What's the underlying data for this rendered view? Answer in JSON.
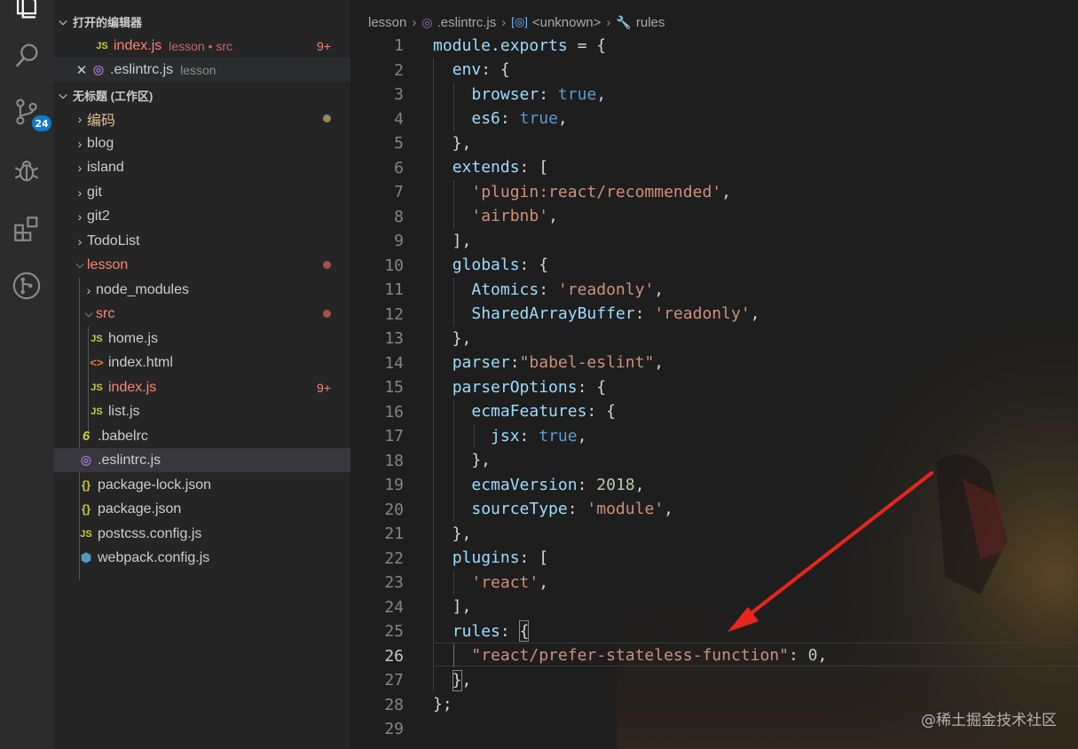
{
  "activity_bar": {
    "icons": [
      "explorer-icon",
      "search-icon",
      "source-control-icon",
      "debug-icon",
      "extensions-icon",
      "git-graph-icon"
    ],
    "source_control_badge": "24"
  },
  "sidebar": {
    "open_editors_header": "打开的编辑器",
    "open_editors": [
      {
        "name": "index.js",
        "path": "lesson • src",
        "count": "9+"
      },
      {
        "name": ".eslintrc.js",
        "path": "lesson"
      }
    ],
    "workspace_header": "无标题 (工作区)",
    "tree": [
      {
        "label": "编码"
      },
      {
        "label": "blog"
      },
      {
        "label": "island"
      },
      {
        "label": "git"
      },
      {
        "label": "git2"
      },
      {
        "label": "TodoList"
      },
      {
        "label": "lesson"
      },
      {
        "label": "node_modules"
      },
      {
        "label": "src"
      },
      {
        "label": "home.js"
      },
      {
        "label": "index.html"
      },
      {
        "label": "index.js",
        "count": "9+"
      },
      {
        "label": "list.js"
      },
      {
        "label": ".babelrc"
      },
      {
        "label": ".eslintrc.js"
      },
      {
        "label": "package-lock.json"
      },
      {
        "label": "package.json"
      },
      {
        "label": "postcss.config.js"
      },
      {
        "label": "webpack.config.js"
      }
    ]
  },
  "breadcrumb": {
    "folder": "lesson",
    "file": ".eslintrc.js",
    "symbol": "<unknown>",
    "property": "rules"
  },
  "editor": {
    "line_numbers": [
      "1",
      "2",
      "3",
      "4",
      "5",
      "6",
      "7",
      "8",
      "9",
      "10",
      "11",
      "12",
      "13",
      "14",
      "15",
      "16",
      "17",
      "18",
      "19",
      "20",
      "21",
      "22",
      "23",
      "24",
      "25",
      "26",
      "27",
      "28",
      "29"
    ]
  },
  "watermark": "@稀土掘金技术社区",
  "colors": {
    "keyword": "#9cdcfe",
    "boolean": "#569cd6",
    "string": "#ce9178",
    "number": "#b5cea8",
    "accent": "#0e7acb",
    "error": "#f48771"
  }
}
